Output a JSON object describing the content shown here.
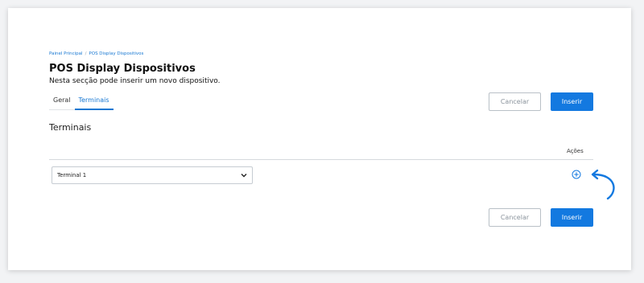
{
  "breadcrumb": {
    "items": [
      "Painel Principal",
      "POS Display Dispositivos"
    ],
    "separator": "/"
  },
  "page": {
    "title": "POS Display Dispositivos",
    "subtitle": "Nesta secção pode inserir um novo dispositivo."
  },
  "tabs": [
    {
      "label": "Geral",
      "active": false
    },
    {
      "label": "Terminais",
      "active": true
    }
  ],
  "buttons": {
    "cancel_label": "Cancelar",
    "insert_label": "Inserir"
  },
  "terminals": {
    "section_title": "Terminais",
    "actions_header": "Ações",
    "selected_terminal": "Terminal 1"
  },
  "icons": {
    "add": "plus-circle-icon",
    "select": "chevron-down-icon",
    "annotation": "curved-arrow-icon"
  },
  "colors": {
    "accent": "#1379e0",
    "link": "#1677d2",
    "cancel_text": "#8a939c"
  }
}
